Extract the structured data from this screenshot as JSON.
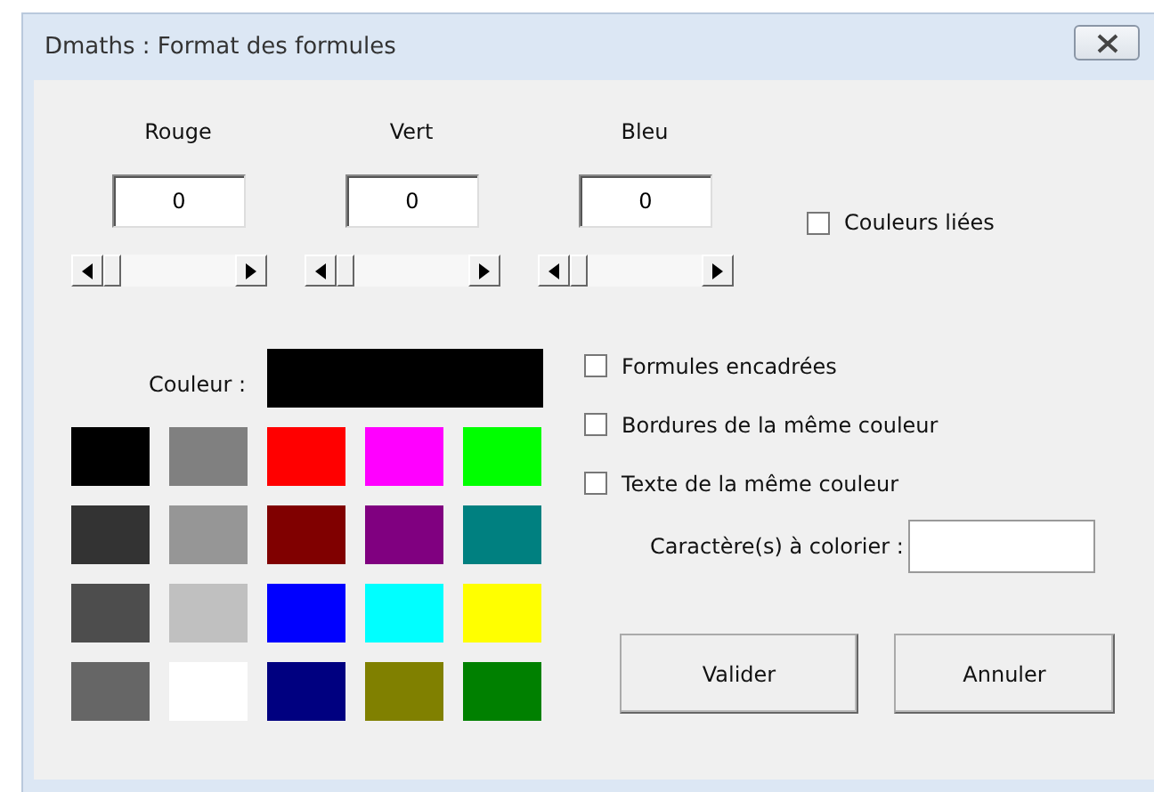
{
  "window": {
    "title": "Dmaths : Format des formules"
  },
  "channels": [
    {
      "label": "Rouge",
      "value": "0",
      "level": 0
    },
    {
      "label": "Vert",
      "value": "0",
      "level": 0
    },
    {
      "label": "Bleu",
      "value": "0",
      "level": 0
    }
  ],
  "linked_colors": {
    "label": "Couleurs liées",
    "checked": false
  },
  "current_color": {
    "label": "Couleur :",
    "color": "#000000"
  },
  "palette": [
    {
      "color": "#000000"
    },
    {
      "color": "#808080"
    },
    {
      "color": "#ff0000"
    },
    {
      "color": "#ff00ff"
    },
    {
      "color": "#00ff00"
    },
    {
      "color": "#333333"
    },
    {
      "color": "#969696"
    },
    {
      "color": "#800000"
    },
    {
      "color": "#800080"
    },
    {
      "color": "#008080"
    },
    {
      "color": "#4d4d4d"
    },
    {
      "color": "#c0c0c0"
    },
    {
      "color": "#0000ff"
    },
    {
      "color": "#00ffff"
    },
    {
      "color": "#ffff00"
    },
    {
      "color": "#666666"
    },
    {
      "color": "#ffffff"
    },
    {
      "color": "#000080"
    },
    {
      "color": "#808000"
    },
    {
      "color": "#008000"
    }
  ],
  "options": [
    {
      "label": "Formules encadrées",
      "checked": false
    },
    {
      "label": "Bordures de la même couleur",
      "checked": false
    },
    {
      "label": "Texte de la même couleur",
      "checked": false
    }
  ],
  "characters_field": {
    "label": "Caractère(s) à colorier :"
  },
  "buttons": [
    "Valider",
    "Annuler"
  ]
}
